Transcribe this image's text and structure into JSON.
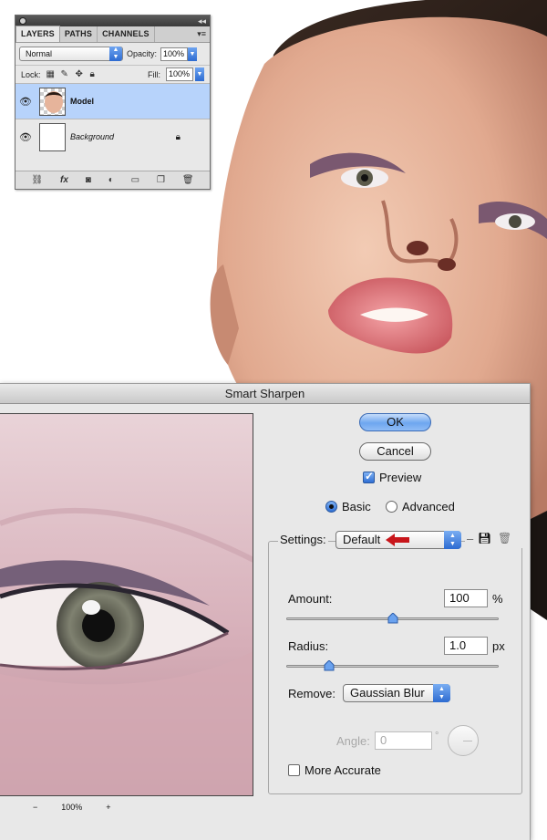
{
  "layers_panel": {
    "tabs": [
      "LAYERS",
      "PATHS",
      "CHANNELS"
    ],
    "blend_mode": "Normal",
    "opacity_label": "Opacity:",
    "opacity_value": "100%",
    "lock_label": "Lock:",
    "fill_label": "Fill:",
    "fill_value": "100%",
    "layers": [
      {
        "name": "Model",
        "selected": true
      },
      {
        "name": "Background",
        "selected": false
      }
    ],
    "bottom_icons": [
      "link-icon",
      "fx-icon",
      "mask-icon",
      "adjustment-icon",
      "folder-icon",
      "new-layer-icon",
      "trash-icon"
    ],
    "fx_label": "fx"
  },
  "dialog": {
    "title": "Smart Sharpen",
    "ok_label": "OK",
    "cancel_label": "Cancel",
    "preview_label": "Preview",
    "preview_checked": true,
    "mode_basic": "Basic",
    "mode_advanced": "Advanced",
    "mode_selected": "Basic",
    "settings_label": "Settings:",
    "settings_value": "Default",
    "amount_label": "Amount:",
    "amount_value": "100",
    "amount_unit": "%",
    "amount_fraction": 0.5,
    "radius_label": "Radius:",
    "radius_value": "1.0",
    "radius_unit": "px",
    "radius_fraction": 0.2,
    "remove_label": "Remove:",
    "remove_value": "Gaussian Blur",
    "angle_label": "Angle:",
    "angle_value": "0",
    "angle_unit": "°",
    "more_accurate_label": "More Accurate",
    "more_accurate_checked": false,
    "zoom_minus": "−",
    "zoom_value": "100%",
    "zoom_plus": "+"
  },
  "colors": {
    "accent_blue": "#2d6bd1",
    "selection": "#b7d3fb",
    "arrow_red": "#c8161b"
  }
}
